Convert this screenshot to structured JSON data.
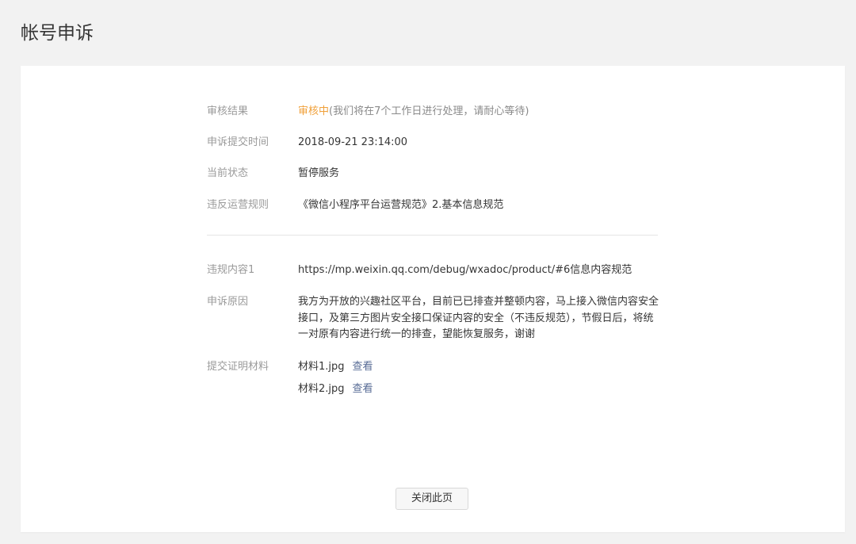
{
  "page": {
    "title": "帐号申诉"
  },
  "details": {
    "review_result": {
      "label": "审核结果",
      "status": "审核中",
      "note": "(我们将在7个工作日进行处理，请耐心等待)"
    },
    "submit_time": {
      "label": "申诉提交时间",
      "value": "2018-09-21 23:14:00"
    },
    "current_status": {
      "label": "当前状态",
      "value": "暂停服务"
    },
    "violated_rule": {
      "label": "违反运营规则",
      "value": "《微信小程序平台运营规范》2.基本信息规范"
    },
    "violation_content": {
      "label": "违规内容1",
      "value": "https://mp.weixin.qq.com/debug/wxadoc/product/#6信息内容规范"
    },
    "appeal_reason": {
      "label": "申诉原因",
      "value": "我方为开放的兴趣社区平台，目前已已排查并整顿内容，马上接入微信内容安全接口，及第三方图片安全接口保证内容的安全（不违反规范），节假日后，将统一对原有内容进行统一的排查，望能恢复服务，谢谢"
    },
    "evidence": {
      "label": "提交证明材料",
      "files": [
        {
          "name": "材料1.jpg",
          "view_label": "查看"
        },
        {
          "name": "材料2.jpg",
          "view_label": "查看"
        }
      ]
    }
  },
  "actions": {
    "close_label": "关闭此页"
  },
  "colors": {
    "background": "#f2f2f2",
    "card": "#ffffff",
    "label": "#9a9a9a",
    "text": "#353535",
    "pending": "#f0a03a",
    "link": "#576b95",
    "divider": "#e5e5e5"
  }
}
